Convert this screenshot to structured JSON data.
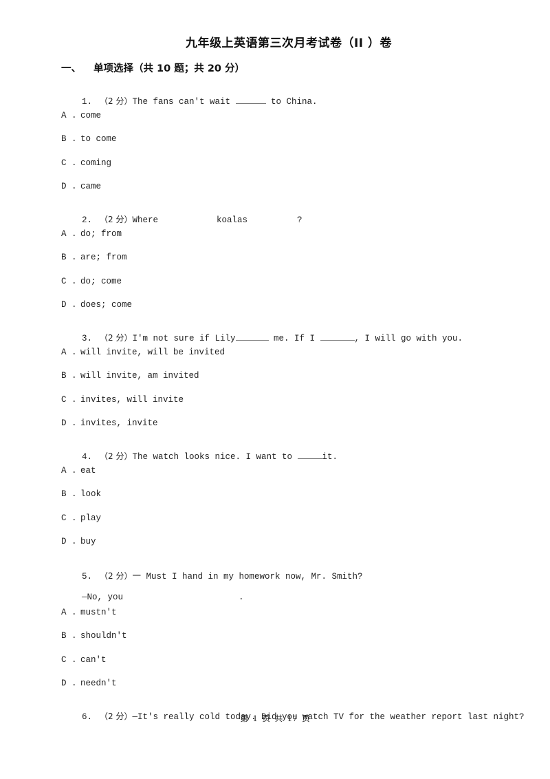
{
  "document": {
    "title": "九年级上英语第三次月考试卷（II ）卷",
    "section": {
      "number": "一、",
      "label": "单项选择（共 10 题；共 20 分）"
    }
  },
  "questions": [
    {
      "number": "1.",
      "score": "（2 分）",
      "text_before": "The fans can't wait ",
      "text_after": " to China.",
      "options": [
        {
          "letter": "A .",
          "text": "come"
        },
        {
          "letter": "B .",
          "text": "to come"
        },
        {
          "letter": "C .",
          "text": "coming"
        },
        {
          "letter": "D .",
          "text": "came"
        }
      ]
    },
    {
      "number": "2.",
      "score": "（2 分）",
      "part1": "Where",
      "part2": "koalas",
      "part3": "?",
      "options": [
        {
          "letter": "A .",
          "text": "do; from"
        },
        {
          "letter": "B .",
          "text": "are; from"
        },
        {
          "letter": "C .",
          "text": "do; come"
        },
        {
          "letter": "D .",
          "text": "does; come"
        }
      ]
    },
    {
      "number": "3.",
      "score": "（2 分）",
      "part1": "I'm not sure if Lily",
      "part2": " me. If I ",
      "part3": ", I will go with you.",
      "options": [
        {
          "letter": "A .",
          "text": "will invite, will be invited"
        },
        {
          "letter": "B .",
          "text": "will invite, am invited"
        },
        {
          "letter": "C .",
          "text": "invites, will invite"
        },
        {
          "letter": "D .",
          "text": "invites, invite"
        }
      ]
    },
    {
      "number": "4.",
      "score": "（2 分）",
      "text_before": "The watch looks nice. I want to ",
      "text_after": "it.",
      "options": [
        {
          "letter": "A .",
          "text": "eat"
        },
        {
          "letter": "B .",
          "text": "look"
        },
        {
          "letter": "C .",
          "text": "play"
        },
        {
          "letter": "D .",
          "text": "buy"
        }
      ]
    },
    {
      "number": "5.",
      "score": "（2 分）",
      "text": "一 Must I hand in my homework now, Mr. Smith?",
      "reply_before": "—No, you",
      "reply_after": ".",
      "options": [
        {
          "letter": "A .",
          "text": "mustn't"
        },
        {
          "letter": "B .",
          "text": "shouldn't"
        },
        {
          "letter": "C .",
          "text": "can't"
        },
        {
          "letter": "D .",
          "text": "needn't"
        }
      ]
    },
    {
      "number": "6.",
      "score": "（2 分）",
      "text": "—It's really cold today. Did you watch TV for the weather report last night?"
    }
  ],
  "footer": {
    "page_info": "第 1 页 共 17 页"
  }
}
